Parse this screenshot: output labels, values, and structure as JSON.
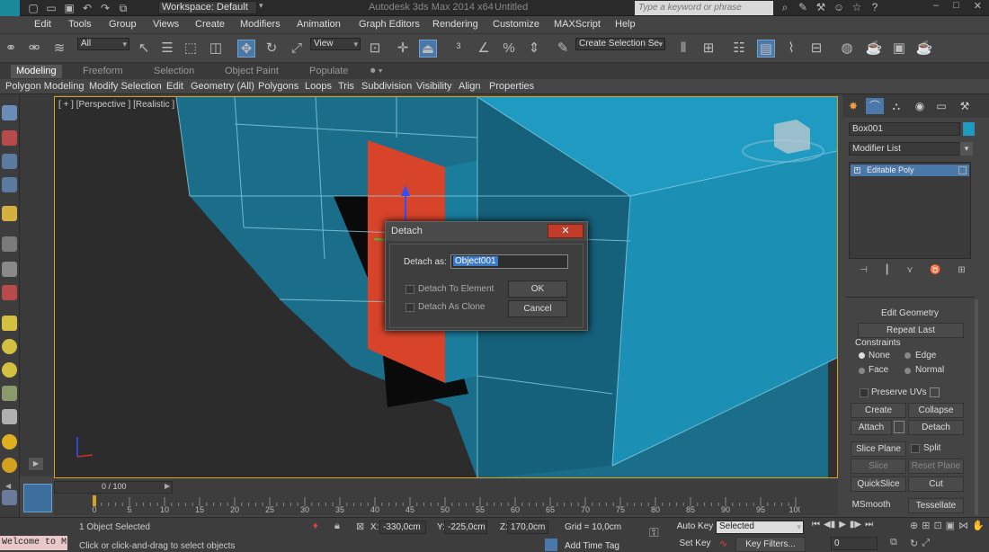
{
  "titlebar": {
    "workspace": "Workspace: Default",
    "title": "Autodesk 3ds Max  2014 x64",
    "doc": "Untitled",
    "search_placeholder": "Type a keyword or phrase"
  },
  "menu": [
    "Edit",
    "Tools",
    "Group",
    "Views",
    "Create",
    "Modifiers",
    "Animation",
    "Graph Editors",
    "Rendering",
    "Customize",
    "MAXScript",
    "Help"
  ],
  "toolbar": {
    "filter": "All",
    "refcoord": "View",
    "selection_set": "Create Selection Se"
  },
  "ribbon_tabs": [
    "Modeling",
    "Freeform",
    "Selection",
    "Object Paint",
    "Populate"
  ],
  "ribbon_sub": [
    "Polygon Modeling",
    "Modify Selection",
    "Edit",
    "Geometry (All)",
    "Polygons",
    "Loops",
    "Tris",
    "Subdivision",
    "Visibility",
    "Align",
    "Properties"
  ],
  "viewport": {
    "label": "[ + ] [Perspective ] [Realistic ]"
  },
  "dialog": {
    "title": "Detach",
    "close": "✕",
    "detach_as_label": "Detach as:",
    "detach_as_value": "Object001",
    "detach_to_element": "Detach To Element",
    "detach_as_clone": "Detach As Clone",
    "ok": "OK",
    "cancel": "Cancel"
  },
  "panel": {
    "object_name": "Box001",
    "modifier_list": "Modifier List",
    "stack_item": "Editable Poly",
    "rollout": "Edit Geometry",
    "repeat_last": "Repeat Last",
    "constraints": "Constraints",
    "none": "None",
    "edge": "Edge",
    "face": "Face",
    "normal": "Normal",
    "preserve_uvs": "Preserve UVs",
    "create": "Create",
    "collapse": "Collapse",
    "attach": "Attach",
    "detach": "Detach",
    "slice_plane": "Slice Plane",
    "split": "Split",
    "slice": "Slice",
    "reset_plane": "Reset Plane",
    "quickslice": "QuickSlice",
    "cut": "Cut",
    "msmooth": "MSmooth",
    "tessellate": "Tessellate"
  },
  "timeline": {
    "frame": "0 / 100",
    "ticks": [
      "0",
      "5",
      "10",
      "15",
      "20",
      "25",
      "30",
      "35",
      "40",
      "45",
      "50",
      "55",
      "60",
      "65",
      "70",
      "75",
      "80",
      "85",
      "90",
      "95",
      "100"
    ]
  },
  "status": {
    "maxscript": "Welcome to M",
    "selected": "1 Object Selected",
    "prompt": "Click or click-and-drag to select objects",
    "x": "-330,0cm",
    "y": "-225,0cm",
    "z": "170,0cm",
    "grid": "Grid = 10,0cm",
    "add_time_tag": "Add Time Tag",
    "auto_key": "Auto Key",
    "selected_dd": "Selected",
    "set_key": "Set Key",
    "key_filters": "Key Filters...",
    "frame_field": "0"
  },
  "colors": {
    "accent": "#4a78a8",
    "viewport_border": "#d4a321",
    "object": "#1f9ac0",
    "detached": "#d8442a",
    "close": "#c13c2a"
  }
}
